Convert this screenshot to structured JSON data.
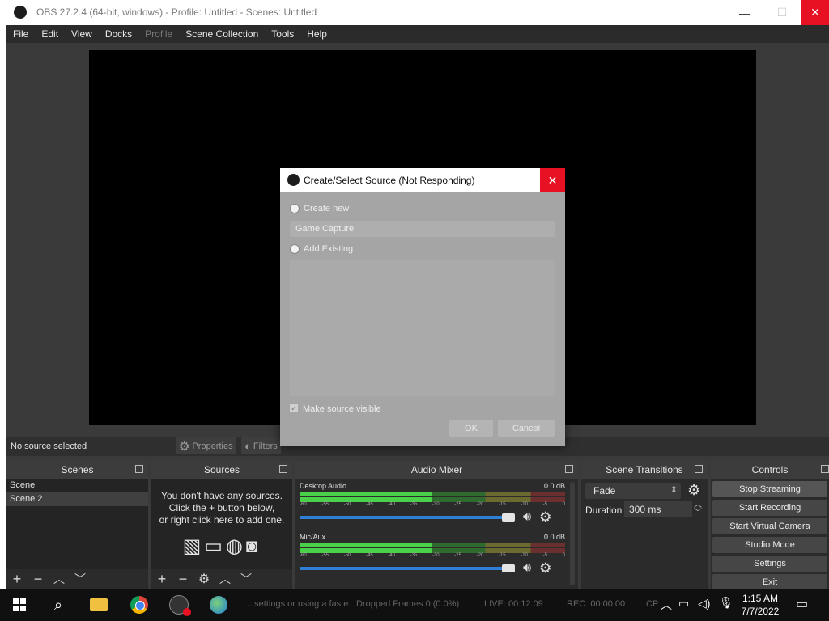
{
  "window": {
    "title": "OBS 27.2.4 (64-bit, windows) - Profile: Untitled - Scenes: Untitled",
    "min": "—",
    "max": "☐",
    "close": "✕"
  },
  "menu": [
    "File",
    "Edit",
    "View",
    "Docks",
    "Profile",
    "Scene Collection",
    "Tools",
    "Help"
  ],
  "source_toolbar": {
    "status": "No source selected",
    "properties": "Properties",
    "filters": "Filters"
  },
  "scenes": {
    "title": "Scenes",
    "items": [
      "Scene",
      "Scene 2"
    ]
  },
  "sources": {
    "title": "Sources",
    "empty_line1": "You don't have any sources.",
    "empty_line2": "Click the + button below,",
    "empty_line3": "or right click here to add one."
  },
  "audio_mixer": {
    "title": "Audio Mixer",
    "channels": [
      {
        "name": "Desktop Audio",
        "db": "0.0 dB"
      },
      {
        "name": "Mic/Aux",
        "db": "0.0 dB"
      }
    ],
    "ticks": [
      "-60",
      "-55",
      "-50",
      "-45",
      "-40",
      "-35",
      "-30",
      "-25",
      "-20",
      "-15",
      "-10",
      "-5",
      "0"
    ]
  },
  "transitions": {
    "title": "Scene Transitions",
    "selected": "Fade",
    "duration_label": "Duration",
    "duration_value": "300 ms"
  },
  "controls": {
    "title": "Controls",
    "buttons": [
      "Stop Streaming",
      "Start Recording",
      "Start Virtual Camera",
      "Studio Mode",
      "Settings",
      "Exit"
    ]
  },
  "dialog": {
    "title": "Create/Select Source (Not Responding)",
    "create_new": "Create new",
    "name_value": "Game Capture",
    "add_existing": "Add Existing",
    "make_visible": "Make source visible",
    "ok": "OK",
    "cancel": "Cancel"
  },
  "statusbar": {
    "dropped": "Dropped Frames 0 (0.0%)",
    "live": "LIVE: 00:12:09",
    "rec": "REC: 00:00:00",
    "message": "...settings or using a faste",
    "cpu": "CP"
  },
  "taskbar": {
    "time": "1:15 AM",
    "date": "7/7/2022"
  },
  "colors": {
    "accent_close": "#e81123",
    "meter_green": "#4ad14a",
    "fader_blue": "#2f7fd6"
  }
}
